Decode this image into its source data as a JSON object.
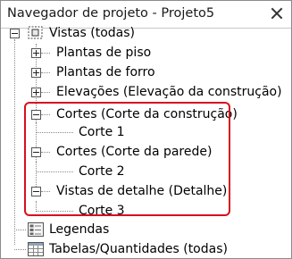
{
  "panel": {
    "title": "Navegador de projeto - Projeto5"
  },
  "tree": {
    "root": {
      "label": "Vistas (todas)",
      "icon": "views-icon"
    },
    "plantas_piso": {
      "label": "Plantas de piso",
      "expanded": false
    },
    "plantas_forro": {
      "label": "Plantas de forro",
      "expanded": false
    },
    "elevacoes": {
      "label": "Elevações (Elevação da construção)",
      "expanded": false
    },
    "cortes_construcao": {
      "label": "Cortes (Corte da construção)",
      "expanded": true,
      "children": [
        "Corte 1"
      ]
    },
    "cortes_parede": {
      "label": "Cortes (Corte da parede)",
      "expanded": true,
      "children": [
        "Corte 2"
      ]
    },
    "vistas_detalhe": {
      "label": "Vistas de detalhe (Detalhe)",
      "expanded": true,
      "children": [
        "Corte 3"
      ]
    },
    "legendas": {
      "label": "Legendas",
      "icon": "legend-icon"
    },
    "tabelas": {
      "label": "Tabelas/Quantidades (todas)",
      "icon": "schedule-icon"
    }
  },
  "colors": {
    "highlight": "#d8101e",
    "border": "#8c8c8c"
  }
}
